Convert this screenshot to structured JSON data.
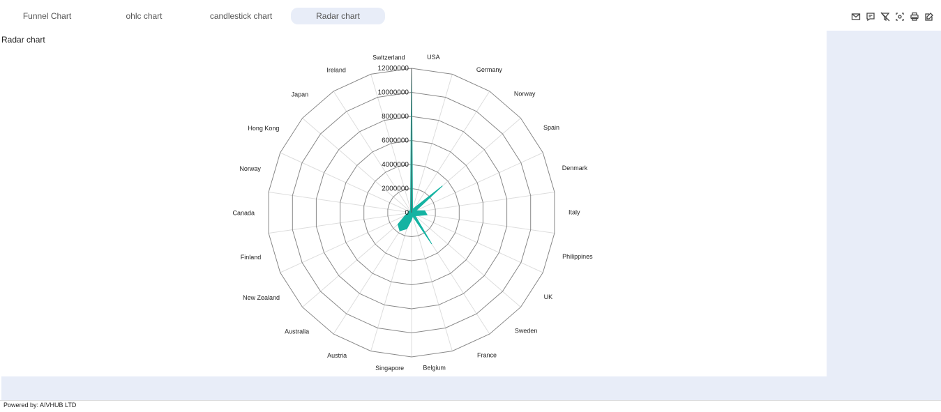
{
  "tabs": [
    {
      "label": "Funnel Chart",
      "active": false
    },
    {
      "label": "ohlc chart",
      "active": false
    },
    {
      "label": "candlestick chart",
      "active": false
    },
    {
      "label": "Radar chart",
      "active": true
    }
  ],
  "toolbar": [
    "mail-icon",
    "comment-icon",
    "filter-off-icon",
    "screenshot-icon",
    "print-icon",
    "edit-icon"
  ],
  "chart_title": "Radar chart",
  "footer": "Powered by: AIVHUB LTD",
  "chart_data": {
    "type": "radar",
    "title": "Radar chart",
    "categories": [
      "USA",
      "Germany",
      "Norway",
      "Spain",
      "Denmark",
      "Italy",
      "Philippines",
      "UK",
      "Sweden",
      "France",
      "Belgium",
      "Singapore",
      "Austria",
      "Australia",
      "New Zealand",
      "Finland",
      "Canada",
      "Norway",
      "Hong Kong",
      "Japan",
      "Ireland",
      "Switzerland"
    ],
    "values": [
      12000000,
      300000,
      500000,
      3400000,
      400000,
      1100000,
      1300000,
      600000,
      400000,
      3100000,
      300000,
      600000,
      1400000,
      1800000,
      1500000,
      600000,
      300000,
      200000,
      300000,
      200000,
      200000,
      300000
    ],
    "rlim": [
      0,
      12000000
    ],
    "ticks": [
      "0",
      "2000000",
      "4000000",
      "6000000",
      "8000000",
      "10000000",
      "12000000"
    ],
    "color": "#14b3a2"
  }
}
